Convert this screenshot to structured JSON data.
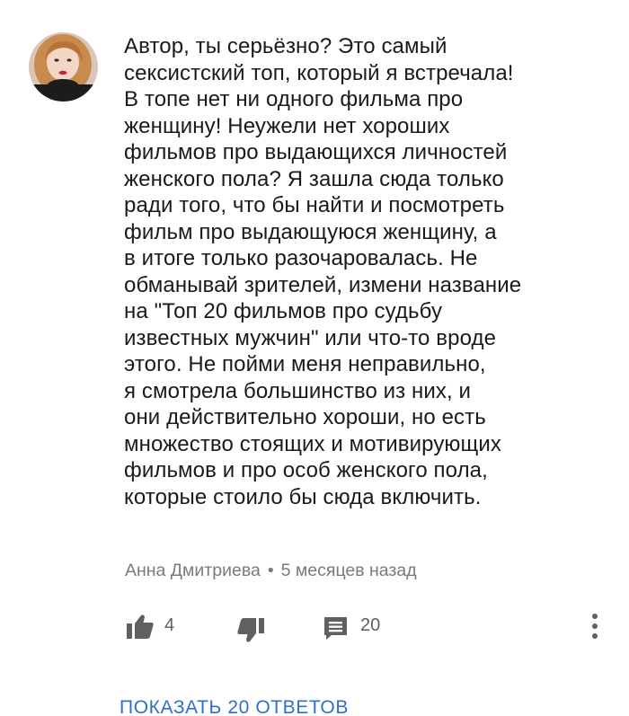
{
  "comment": {
    "text": "Автор, ты серьёзно?  Это самый\nсексистский топ, который я встречала!\nВ топе нет ни одного фильма про\nженщину! Неужели нет хороших\nфильмов про выдающихся личностей\nженского пола? Я зашла сюда только\nради того, что бы найти и  посмотреть\nфильм про выдающуюся женщину, а\nв итоге только разочаровалась.  Не\nобманывай зрителей, измени название\nна \"Топ  20 фильмов про судьбу\nизвестных мужчин\" или что-то вроде\nэтого. Не пойми меня неправильно,\nя смотрела большинство из них, и\nони действительно хороши, но есть\nмножество стоящих и мотивирующих\nфильмов и про особ женского пола,\nкоторые стоило бы сюда включить.",
    "author": "Анна Дмитриева",
    "separator": "•",
    "time": "5 месяцев назад",
    "likes": "4",
    "replies": "20",
    "show_replies_label": "ПОКАЗАТЬ 20 ОТВЕТОВ"
  },
  "icons": {
    "like": "thumbs-up-icon",
    "dislike": "thumbs-down-icon",
    "reply": "comment-icon",
    "more": "more-vert-icon"
  },
  "colors": {
    "text": "#1a1a1a",
    "meta": "#7a7a7a",
    "icon": "#606060",
    "link": "#2f6ecf"
  }
}
